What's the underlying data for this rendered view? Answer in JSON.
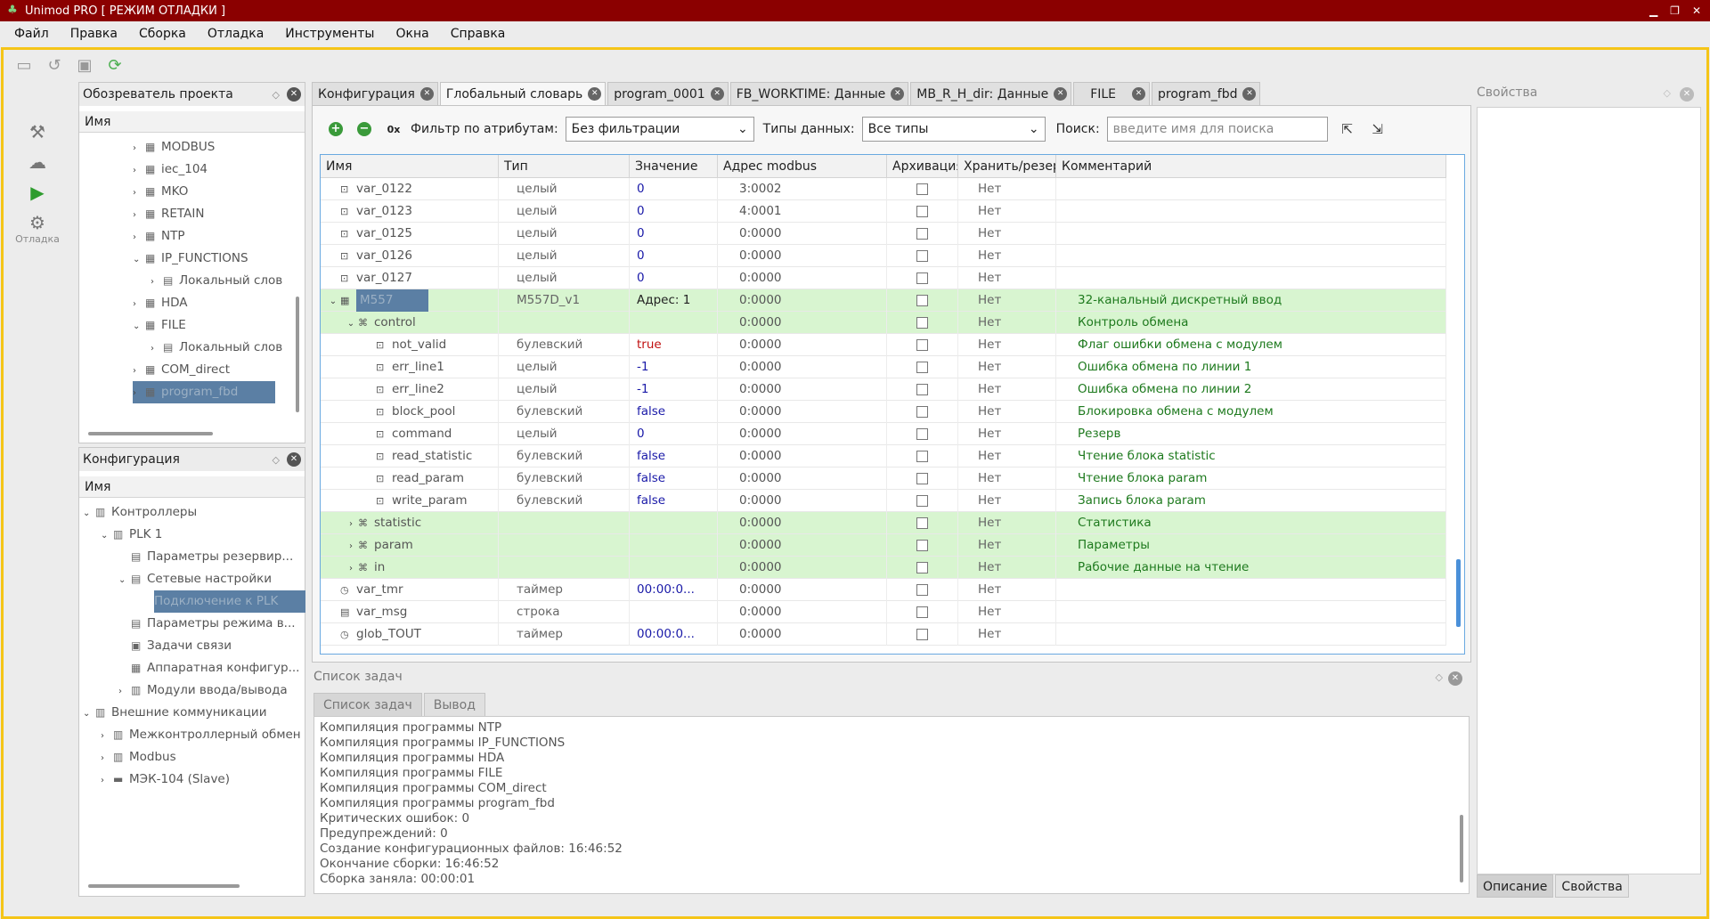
{
  "app": {
    "title": "Unimod PRO  [ РЕЖИМ ОТЛАДКИ ]"
  },
  "menu": [
    "Файл",
    "Правка",
    "Сборка",
    "Отладка",
    "Инструменты",
    "Окна",
    "Справка"
  ],
  "left_strip": {
    "debug_label": "Отладка"
  },
  "project_explorer": {
    "title": "Обозреватель проекта",
    "column": "Имя",
    "items": [
      {
        "label": "MODBUS"
      },
      {
        "label": "iec_104"
      },
      {
        "label": "MKO"
      },
      {
        "label": "RETAIN"
      },
      {
        "label": "NTP"
      },
      {
        "label": "IP_FUNCTIONS"
      },
      {
        "label": "Локальный слов"
      },
      {
        "label": "HDA"
      },
      {
        "label": "FILE"
      },
      {
        "label": "Локальный слов"
      },
      {
        "label": "COM_direct"
      },
      {
        "label": "program_fbd"
      }
    ]
  },
  "configuration": {
    "title": "Конфигурация",
    "column": "Имя",
    "items": [
      {
        "label": "Контроллеры"
      },
      {
        "label": "PLK 1"
      },
      {
        "label": "Параметры резервир..."
      },
      {
        "label": "Сетевые настройки"
      },
      {
        "label": "Подключение к PLK"
      },
      {
        "label": "Параметры режима в..."
      },
      {
        "label": "Задачи связи"
      },
      {
        "label": "Аппаратная конфигур..."
      },
      {
        "label": "Модули ввода/вывода"
      },
      {
        "label": "Внешние коммуникации"
      },
      {
        "label": "Межконтроллерный обмен"
      },
      {
        "label": "Modbus"
      },
      {
        "label": "МЭК-104 (Slave)"
      }
    ]
  },
  "tabs": [
    {
      "label": "Конфигурация"
    },
    {
      "label": "Глобальный словарь"
    },
    {
      "label": "program_0001"
    },
    {
      "label": "FB_WORKTIME: Данные"
    },
    {
      "label": "MB_R_H_dir: Данные"
    },
    {
      "label": "FILE"
    },
    {
      "label": "program_fbd"
    }
  ],
  "filter": {
    "zero_label": "0x",
    "attr_label": "Фильтр по атрибутам:",
    "attr_value": "Без фильтрации",
    "types_label": "Типы данных:",
    "types_value": "Все типы",
    "search_label": "Поиск:",
    "search_placeholder": "введите имя для поиска"
  },
  "grid": {
    "headers": [
      "Имя",
      "Тип",
      "Значение",
      "Адрес modbus",
      "Архивация",
      "Хранить/резерв",
      "Комментарий"
    ],
    "rows": [
      {
        "name": "var_0122",
        "type": "целый",
        "value": "0",
        "addr": "3:0002",
        "keep": "Нет",
        "comment": ""
      },
      {
        "name": "var_0123",
        "type": "целый",
        "value": "0",
        "addr": "4:0001",
        "keep": "Нет",
        "comment": ""
      },
      {
        "name": "var_0125",
        "type": "целый",
        "value": "0",
        "addr": "0:0000",
        "keep": "Нет",
        "comment": ""
      },
      {
        "name": "var_0126",
        "type": "целый",
        "value": "0",
        "addr": "0:0000",
        "keep": "Нет",
        "comment": ""
      },
      {
        "name": "var_0127",
        "type": "целый",
        "value": "0",
        "addr": "0:0000",
        "keep": "Нет",
        "comment": ""
      },
      {
        "name": "M557",
        "type": "M557D_v1",
        "value": "Адрес: 1",
        "addr": "0:0000",
        "keep": "Нет",
        "comment": "32-канальный дискретный ввод"
      },
      {
        "name": "control",
        "type": "",
        "value": "",
        "addr": "0:0000",
        "keep": "Нет",
        "comment": "Контроль обмена"
      },
      {
        "name": "not_valid",
        "type": "булевский",
        "value": "true",
        "addr": "0:0000",
        "keep": "Нет",
        "comment": "Флаг ошибки обмена с модулем"
      },
      {
        "name": "err_line1",
        "type": "целый",
        "value": "-1",
        "addr": "0:0000",
        "keep": "Нет",
        "comment": "Ошибка обмена по линии 1"
      },
      {
        "name": "err_line2",
        "type": "целый",
        "value": "-1",
        "addr": "0:0000",
        "keep": "Нет",
        "comment": "Ошибка обмена по линии 2"
      },
      {
        "name": "block_pool",
        "type": "булевский",
        "value": "false",
        "addr": "0:0000",
        "keep": "Нет",
        "comment": "Блокировка обмена с модулем"
      },
      {
        "name": "command",
        "type": "целый",
        "value": "0",
        "addr": "0:0000",
        "keep": "Нет",
        "comment": "Резерв"
      },
      {
        "name": "read_statistic",
        "type": "булевский",
        "value": "false",
        "addr": "0:0000",
        "keep": "Нет",
        "comment": "Чтение блока statistic"
      },
      {
        "name": "read_param",
        "type": "булевский",
        "value": "false",
        "addr": "0:0000",
        "keep": "Нет",
        "comment": "Чтение блока param"
      },
      {
        "name": "write_param",
        "type": "булевский",
        "value": "false",
        "addr": "0:0000",
        "keep": "Нет",
        "comment": "Запись блока param"
      },
      {
        "name": "statistic",
        "type": "",
        "value": "",
        "addr": "0:0000",
        "keep": "Нет",
        "comment": "Статистика"
      },
      {
        "name": "param",
        "type": "",
        "value": "",
        "addr": "0:0000",
        "keep": "Нет",
        "comment": "Параметры"
      },
      {
        "name": "in",
        "type": "",
        "value": "",
        "addr": "0:0000",
        "keep": "Нет",
        "comment": "Рабочие данные на чтение"
      },
      {
        "name": "var_tmr",
        "type": "таймер",
        "value": "00:00:0...",
        "addr": "0:0000",
        "keep": "Нет",
        "comment": ""
      },
      {
        "name": "var_msg",
        "type": "строка",
        "value": "",
        "addr": "0:0000",
        "keep": "Нет",
        "comment": ""
      },
      {
        "name": "glob_TOUT",
        "type": "таймер",
        "value": "00:00:0...",
        "addr": "0:0000",
        "keep": "Нет",
        "comment": ""
      }
    ]
  },
  "tasks": {
    "title": "Список задач",
    "tabs": [
      "Список задач",
      "Вывод"
    ],
    "log": [
      "Компиляция программы NTP",
      "Компиляция программы IP_FUNCTIONS",
      "Компиляция программы HDA",
      "Компиляция программы FILE",
      "Компиляция программы COM_direct",
      "Компиляция программы program_fbd",
      "Критических ошибок: 0",
      "Предупреждений: 0",
      "Создание конфигурационных файлов: 16:46:52",
      "Окончание сборки: 16:46:52",
      "Сборка заняла: 00:00:01"
    ]
  },
  "properties": {
    "title": "Свойства",
    "tabs": [
      "Описание",
      "Свойства"
    ]
  },
  "colors": {
    "title_bg": "#8b0000",
    "frame": "#f5c518",
    "selection": "#5b7fa4",
    "group_row": "#d8f5d0",
    "comment": "#1e7a1e",
    "value": "#1a1aa8"
  }
}
